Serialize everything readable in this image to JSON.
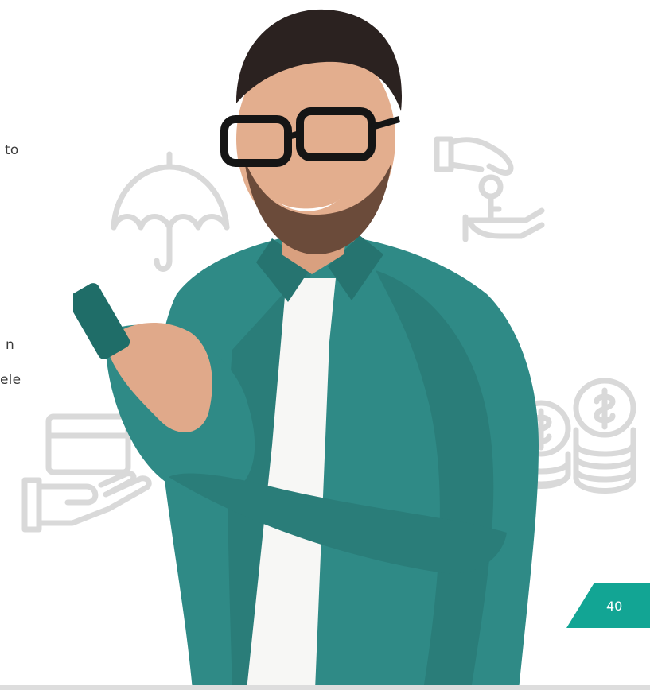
{
  "text_fragments": [
    "to",
    "n",
    "ele"
  ],
  "page_number": "40",
  "colors": {
    "accent": "#12a594",
    "shirt": "#2f8a86",
    "icon_stroke": "#d9d9d9",
    "text": "#3a3a3a"
  },
  "icons": [
    "umbrella-icon",
    "hand-key-icon",
    "card-in-hand-icon",
    "coin-stack-icon"
  ]
}
